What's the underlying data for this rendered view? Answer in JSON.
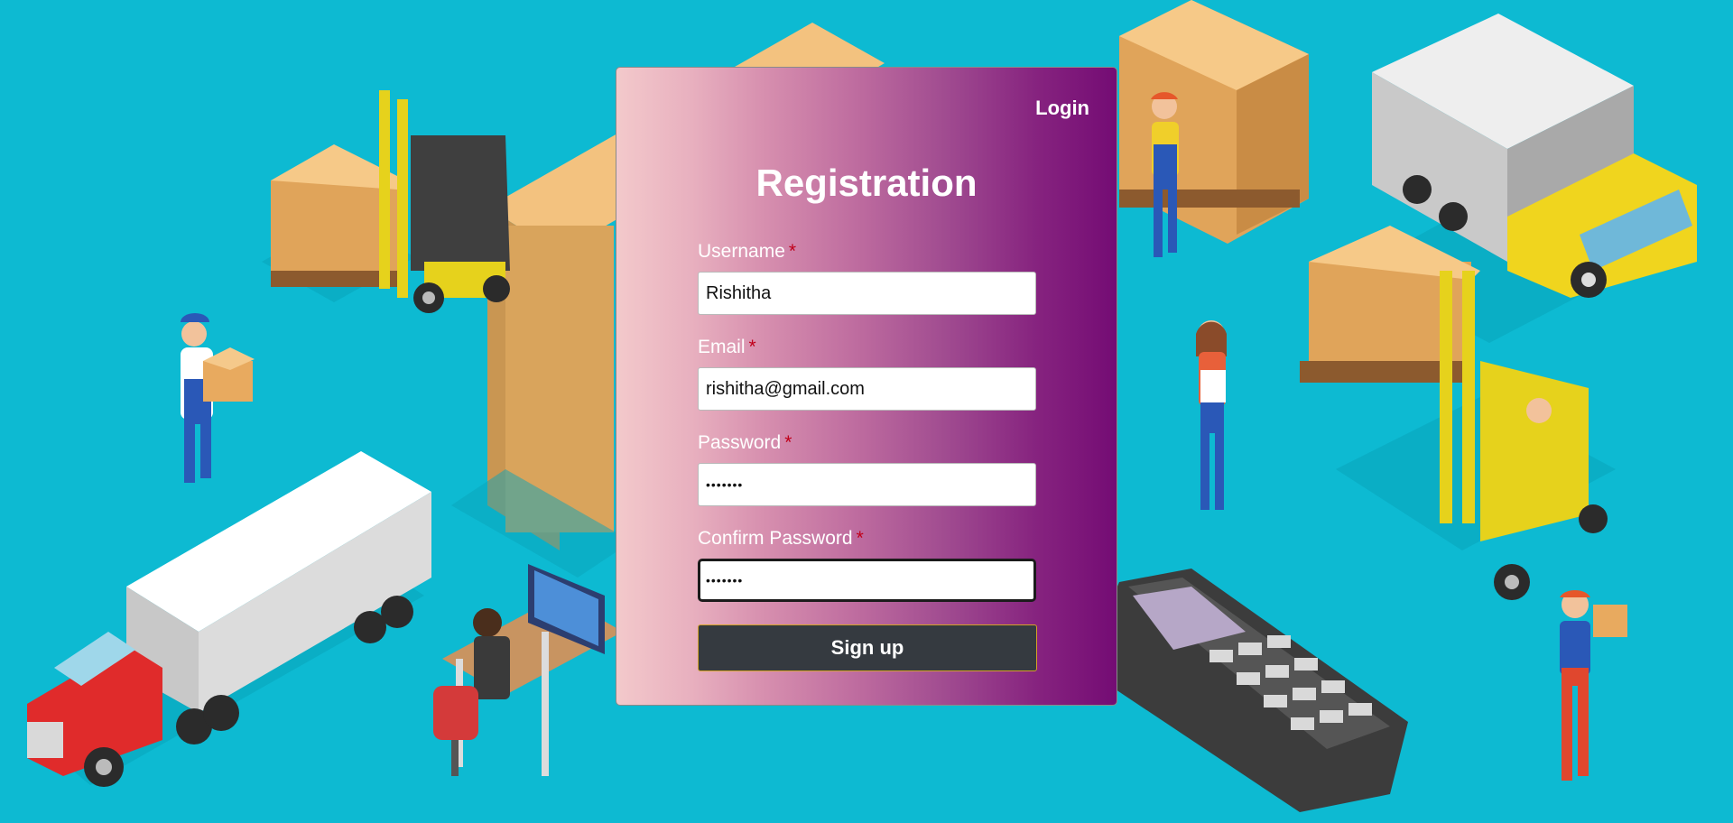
{
  "nav": {
    "login_label": "Login"
  },
  "form": {
    "title": "Registration",
    "required_mark": "*",
    "fields": [
      {
        "label": "Username",
        "value": "Rishitha",
        "type": "text"
      },
      {
        "label": "Email",
        "value": "rishitha@gmail.com",
        "type": "email"
      },
      {
        "label": "Password",
        "value": "•••••••",
        "type": "password"
      },
      {
        "label": "Confirm Password",
        "value": "•••••••",
        "type": "password",
        "focused": true
      }
    ],
    "submit_label": "Sign up"
  },
  "colors": {
    "background": "#0dbad2",
    "card_gradient_start": "#f3c9cb",
    "card_gradient_end": "#740c74",
    "required_mark": "#c0001a",
    "button": "#353a40"
  },
  "illustrations": [
    "forklift-with-boxes-icon",
    "worker-carrying-box-icon",
    "large-cardboard-box-icon",
    "semi-truck-icon",
    "office-worker-at-desk-icon",
    "stacked-pallets-icon",
    "box-truck-icon",
    "woman-with-clipboard-icon",
    "forklift-driver-icon",
    "payment-terminal-icon",
    "worker-with-package-icon"
  ]
}
